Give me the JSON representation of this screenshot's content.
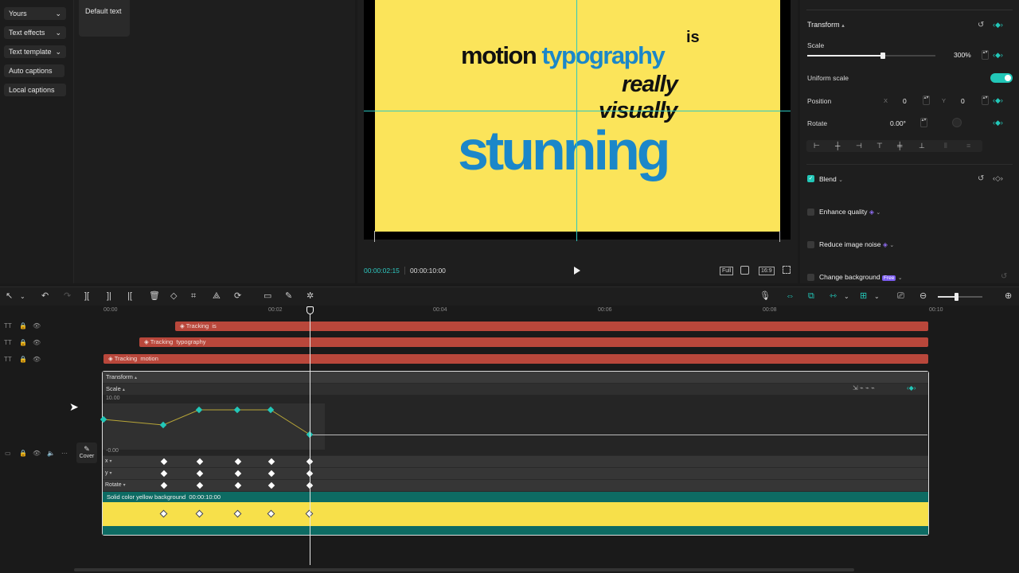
{
  "left_panel": {
    "items": [
      {
        "label": "Yours",
        "chevron": "⌄"
      },
      {
        "label": "Text effects",
        "chevron": "⌄"
      },
      {
        "label": "Text template",
        "chevron": "⌄"
      },
      {
        "label": "Auto captions",
        "chevron": ""
      },
      {
        "label": "Local captions",
        "chevron": ""
      }
    ],
    "default_text_card": "Default text"
  },
  "preview": {
    "line_motion": "motion",
    "line_typography": "typography",
    "line_is": "is",
    "line_really": "really",
    "line_visually": "visually",
    "line_stunning": "stunning",
    "current_time": "00:00:02:15",
    "total_time": "00:00:10:00",
    "full_label": "Full",
    "ratio_label": "16:9",
    "bg_color": "#fbe45a",
    "blue_color": "#1b87c9"
  },
  "inspector": {
    "transform_title": "Transform",
    "scale_label": "Scale",
    "scale_value": "300%",
    "scale_fraction": 0.59,
    "uniform_scale_label": "Uniform scale",
    "uniform_scale_on": true,
    "position_label": "Position",
    "pos_x_label": "X",
    "pos_x_value": "0",
    "pos_y_label": "Y",
    "pos_y_value": "0",
    "rotate_label": "Rotate",
    "rotate_value": "0.00°",
    "blend_label": "Blend",
    "enhance_label": "Enhance quality",
    "noise_label": "Reduce image noise",
    "change_bg_label": "Change background",
    "free_badge": "Free",
    "accent": "#22c7b8"
  },
  "timeline": {
    "ruler": [
      "00:00",
      "00:02",
      "00:04",
      "00:06",
      "00:08",
      "00:10"
    ],
    "tracks": [
      {
        "label": "Tracking",
        "text": "is"
      },
      {
        "label": "Tracking",
        "text": "typography"
      },
      {
        "label": "Tracking",
        "text": "motion"
      }
    ],
    "transform_label": "Transform",
    "scale_label": "Scale",
    "graph_max": "10.00",
    "graph_min": "-0.00",
    "row_x": "x",
    "row_y": "y",
    "row_rotate": "Rotate",
    "bg_clip_label": "Solid color yellow background",
    "bg_clip_duration": "00:00:10:00",
    "cover_label": "Cover",
    "clip_color": "#b9473b"
  }
}
